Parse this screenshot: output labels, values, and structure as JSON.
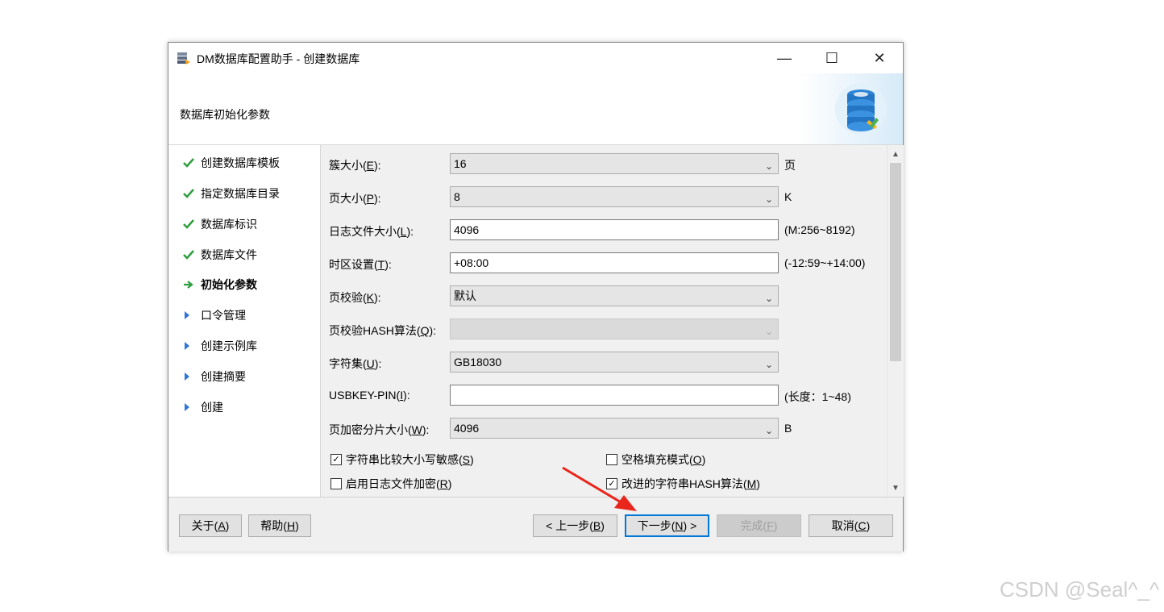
{
  "window": {
    "title": "DM数据库配置助手 - 创建数据库",
    "minimize": "—",
    "maximize": "☐",
    "close": "✕"
  },
  "banner": {
    "title": "数据库初始化参数"
  },
  "steps": [
    {
      "label": "创建数据库模板",
      "state": "done"
    },
    {
      "label": "指定数据库目录",
      "state": "done"
    },
    {
      "label": "数据库标识",
      "state": "done"
    },
    {
      "label": "数据库文件",
      "state": "done"
    },
    {
      "label": "初始化参数",
      "state": "current"
    },
    {
      "label": "口令管理",
      "state": "pending"
    },
    {
      "label": "创建示例库",
      "state": "pending"
    },
    {
      "label": "创建摘要",
      "state": "pending"
    },
    {
      "label": "创建",
      "state": "pending"
    }
  ],
  "form": {
    "cluster_size": {
      "label": "簇大小(",
      "key": "E",
      "label_end": "):",
      "value": "16",
      "unit": "页"
    },
    "page_size": {
      "label": "页大小(",
      "key": "P",
      "label_end": "):",
      "value": "8",
      "unit": "K"
    },
    "log_file_size": {
      "label": "日志文件大小(",
      "key": "L",
      "label_end": "):",
      "value": "4096",
      "unit": "(M:256~8192)"
    },
    "time_zone": {
      "label": "时区设置(",
      "key": "T",
      "label_end": "):",
      "value": "+08:00",
      "unit": "(-12:59~+14:00)"
    },
    "page_check": {
      "label": "页校验(",
      "key": "K",
      "label_end": "):",
      "value": "默认"
    },
    "page_check_hash": {
      "label": "页校验HASH算法(",
      "key": "Q",
      "label_end": "):",
      "value": ""
    },
    "charset": {
      "label": "字符集(",
      "key": "U",
      "label_end": "):",
      "value": "GB18030"
    },
    "usbkey_pin": {
      "label": "USBKEY-PIN(",
      "key": "I",
      "label_end": "):",
      "value": "",
      "unit": "(长度：1~48)"
    },
    "page_enc_slice": {
      "label": "页加密分片大小(",
      "key": "W",
      "label_end": "):",
      "value": "4096",
      "unit": "B"
    }
  },
  "checkboxes": {
    "case_sensitive": {
      "label": "字符串比较大小写敏感(",
      "key": "S",
      "label_end": ")",
      "checked": true
    },
    "blank_pad": {
      "label": "空格填充模式(",
      "key": "O",
      "label_end": ")",
      "checked": false
    },
    "log_encrypt": {
      "label": "启用日志文件加密(",
      "key": "R",
      "label_end": ")",
      "checked": false
    },
    "improved_hash": {
      "label": "改进的字符串HASH算法(",
      "key": "M",
      "label_end": ")",
      "checked": true
    }
  },
  "buttons": {
    "about": {
      "label": "关于(",
      "key": "A",
      "label_end": ")"
    },
    "help": {
      "label": "帮助(",
      "key": "H",
      "label_end": ")"
    },
    "prev": {
      "label": "< 上一步(",
      "key": "B",
      "label_end": ")"
    },
    "next": {
      "label": "下一步(",
      "key": "N",
      "label_end": ") >"
    },
    "finish": {
      "label": "完成(",
      "key": "F",
      "label_end": ")"
    },
    "cancel": {
      "label": "取消(",
      "key": "C",
      "label_end": ")"
    }
  },
  "watermark": "CSDN @Seal^_^",
  "colors": {
    "accent": "#0078d7",
    "check": "#2e9e3e",
    "arrow": "#2e75d6",
    "annotation": "#e8261c"
  }
}
